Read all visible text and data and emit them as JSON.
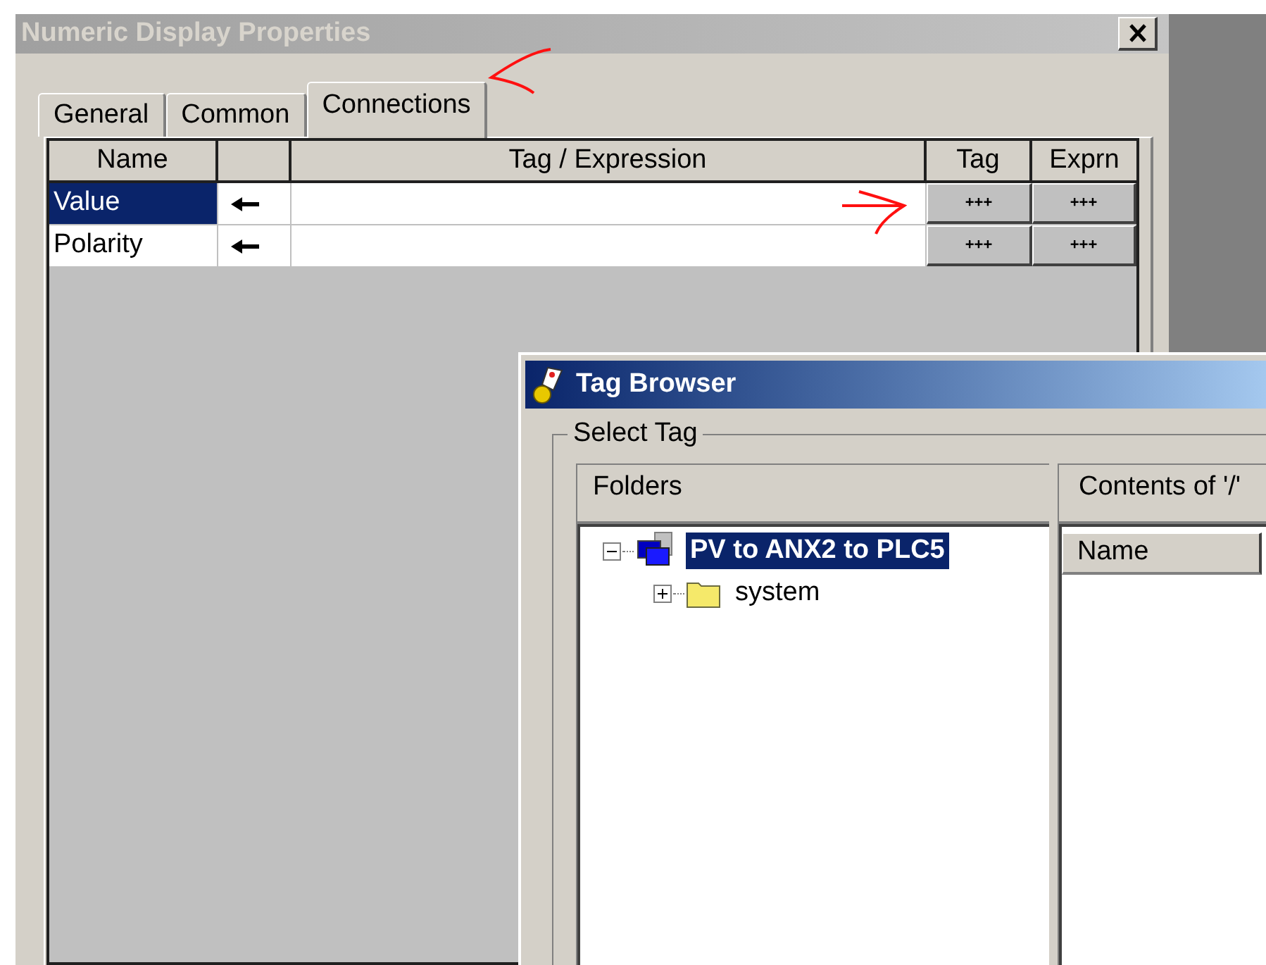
{
  "properties_window": {
    "title": "Numeric Display Properties",
    "active": false,
    "tabs": [
      {
        "label": "General",
        "selected": false
      },
      {
        "label": "Common",
        "selected": false
      },
      {
        "label": "Connections",
        "selected": true
      }
    ],
    "table": {
      "columns": {
        "name": "Name",
        "tag_expression": "Tag / Expression",
        "tag": "Tag",
        "exprn": "Exprn"
      },
      "rows": [
        {
          "name": "Value",
          "selected": true,
          "tag_button": "+++",
          "exprn_button": "+++"
        },
        {
          "name": "Polarity",
          "selected": false,
          "tag_button": "+++",
          "exprn_button": "+++"
        }
      ]
    }
  },
  "tag_browser": {
    "title": "Tag Browser",
    "active": true,
    "group": "Select Tag",
    "folders": {
      "header": "Folders",
      "tree": [
        {
          "label": "PV to ANX2 to PLC5",
          "kind": "server",
          "expanded": true,
          "selected": true,
          "children": [
            {
              "label": "system",
              "kind": "folder",
              "expanded": false,
              "selected": false
            }
          ]
        }
      ]
    },
    "contents": {
      "header": "Contents of '/'",
      "columns": [
        "Name"
      ]
    }
  }
}
